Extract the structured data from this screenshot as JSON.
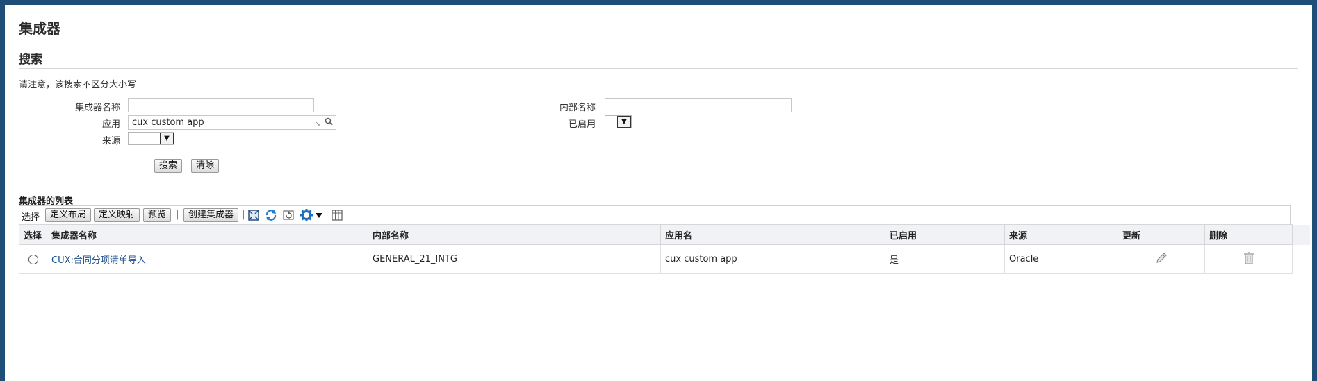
{
  "page": {
    "title": "集成器"
  },
  "search": {
    "title": "搜索",
    "note": "请注意，该搜索不区分大小写",
    "fields": {
      "integrator_name_label": "集成器名称",
      "integrator_name_value": "",
      "application_label": "应用",
      "application_value": "cux custom app",
      "source_label": "来源",
      "source_value": "",
      "internal_name_label": "内部名称",
      "internal_name_value": "",
      "enabled_label": "已启用",
      "enabled_value": ""
    },
    "buttons": {
      "search": "搜索",
      "clear": "清除"
    }
  },
  "list": {
    "title": "集成器的列表",
    "toolbar": {
      "select_label": "选择",
      "define_layout": "定义布局",
      "define_mapping": "定义映射",
      "preview": "预览",
      "separator": "|",
      "create_integrator": "创建集成器",
      "icons": [
        "detach-icon",
        "refresh-icon",
        "reset-icon",
        "settings-icon",
        "dropdown-icon",
        "columns-icon"
      ]
    },
    "columns": [
      "选择",
      "集成器名称",
      "内部名称",
      "应用名",
      "已启用",
      "来源",
      "更新",
      "删除"
    ],
    "rows": [
      {
        "name": "CUX:合同分项清单导入",
        "internal_name": "GENERAL_21_INTG",
        "application": "cux custom app",
        "enabled": "是",
        "source": "Oracle",
        "update_icon": "pencil-icon",
        "delete_icon": "trash-icon"
      }
    ]
  },
  "colors": {
    "frame": "#1f4e79",
    "link": "#1a4f8b",
    "header_bg": "#f0f2f5"
  }
}
